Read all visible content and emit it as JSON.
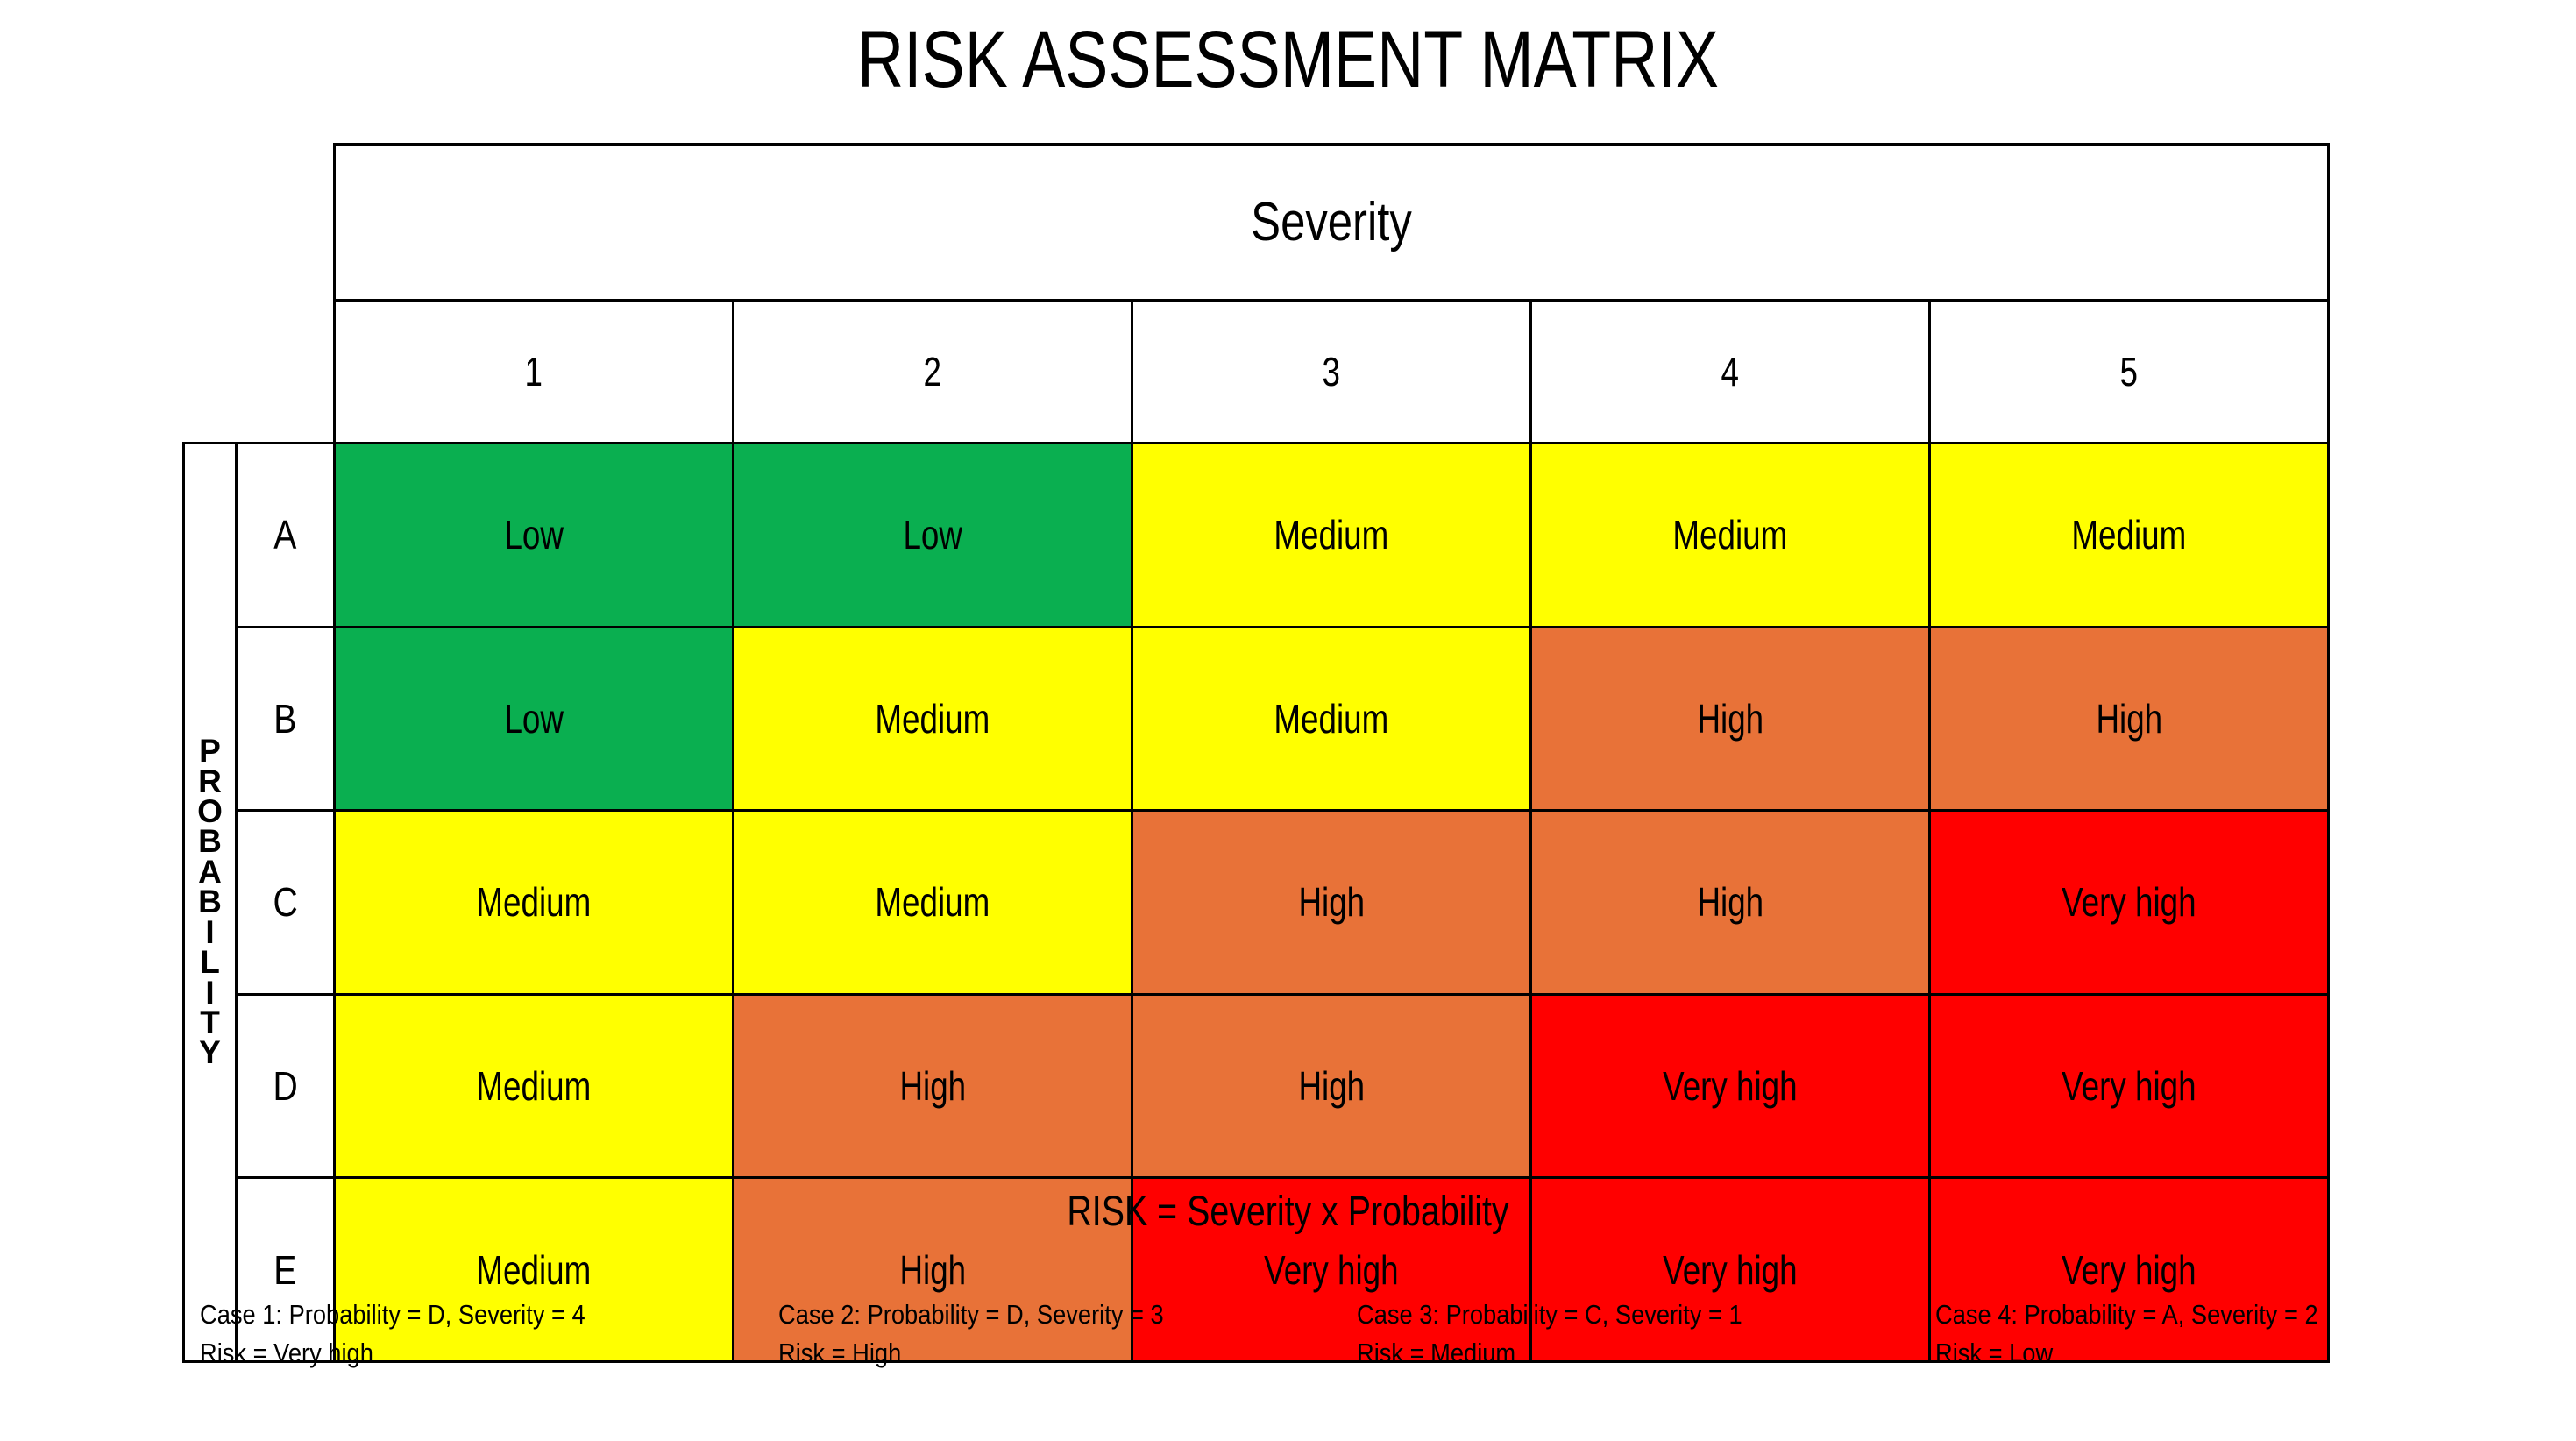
{
  "title": "RISK ASSESSMENT MATRIX",
  "axes": {
    "severity_label": "Severity",
    "probability_label": "PROBABILITY",
    "probability_letters": [
      "P",
      "R",
      "O",
      "B",
      "A",
      "B",
      "I",
      "L",
      "I",
      "T",
      "Y"
    ],
    "severity_levels": [
      "1",
      "2",
      "3",
      "4",
      "5"
    ],
    "probability_levels": [
      "A",
      "B",
      "C",
      "D",
      "E"
    ]
  },
  "formula": "RISK = Severity x Probability",
  "legend_colors": {
    "low": "#0AAF50",
    "medium": "#FFFF00",
    "high": "#E87238",
    "very_high": "#FF0000",
    "border": "#000000",
    "background": "#FFFFFF"
  },
  "chart_data": {
    "type": "heatmap",
    "title": "RISK ASSESSMENT MATRIX",
    "xlabel": "Severity",
    "ylabel": "PROBABILITY",
    "x": [
      "1",
      "2",
      "3",
      "4",
      "5"
    ],
    "y": [
      "A",
      "B",
      "C",
      "D",
      "E"
    ],
    "grid": true,
    "legend_position": "none",
    "categories_scale": [
      "Low",
      "Medium",
      "High",
      "Very high"
    ],
    "category_colors": {
      "Low": "#0AAF50",
      "Medium": "#FFFF00",
      "High": "#E87238",
      "Very high": "#FF0000"
    },
    "cells": [
      [
        "Low",
        "Low",
        "Medium",
        "Medium",
        "Medium"
      ],
      [
        "Low",
        "Medium",
        "Medium",
        "High",
        "High"
      ],
      [
        "Medium",
        "Medium",
        "High",
        "High",
        "Very high"
      ],
      [
        "Medium",
        "High",
        "High",
        "Very high",
        "Very high"
      ],
      [
        "Medium",
        "High",
        "Very high",
        "Very high",
        "Very high"
      ]
    ]
  },
  "matrix": {
    "rows": [
      {
        "label": "A",
        "cells": [
          {
            "text": "Low",
            "color": "#0AAF50"
          },
          {
            "text": "Low",
            "color": "#0AAF50"
          },
          {
            "text": "Medium",
            "color": "#FFFF00"
          },
          {
            "text": "Medium",
            "color": "#FFFF00"
          },
          {
            "text": "Medium",
            "color": "#FFFF00"
          }
        ]
      },
      {
        "label": "B",
        "cells": [
          {
            "text": "Low",
            "color": "#0AAF50"
          },
          {
            "text": "Medium",
            "color": "#FFFF00"
          },
          {
            "text": "Medium",
            "color": "#FFFF00"
          },
          {
            "text": "High",
            "color": "#E87238"
          },
          {
            "text": "High",
            "color": "#E87238"
          }
        ]
      },
      {
        "label": "C",
        "cells": [
          {
            "text": "Medium",
            "color": "#FFFF00"
          },
          {
            "text": "Medium",
            "color": "#FFFF00"
          },
          {
            "text": "High",
            "color": "#E87238"
          },
          {
            "text": "High",
            "color": "#E87238"
          },
          {
            "text": "Very high",
            "color": "#FF0000"
          }
        ]
      },
      {
        "label": "D",
        "cells": [
          {
            "text": "Medium",
            "color": "#FFFF00"
          },
          {
            "text": "High",
            "color": "#E87238"
          },
          {
            "text": "High",
            "color": "#E87238"
          },
          {
            "text": "Very high",
            "color": "#FF0000"
          },
          {
            "text": "Very high",
            "color": "#FF0000"
          }
        ]
      },
      {
        "label": "E",
        "cells": [
          {
            "text": "Medium",
            "color": "#FFFF00"
          },
          {
            "text": "High",
            "color": "#E87238"
          },
          {
            "text": "Very high",
            "color": "#FF0000"
          },
          {
            "text": "Very high",
            "color": "#FF0000"
          },
          {
            "text": "Very high",
            "color": "#FF0000"
          }
        ]
      }
    ]
  },
  "cases": [
    {
      "line1": "Case 1: Probability = D, Severity = 4",
      "line2": "Risk = Very high"
    },
    {
      "line1": "Case 2: Probability = D, Severity = 3",
      "line2": "Risk = High"
    },
    {
      "line1": "Case 3: Probability = C, Severity = 1",
      "line2": "Risk = Medium"
    },
    {
      "line1": "Case 4: Probability = A, Severity = 2",
      "line2": "Risk = Low"
    }
  ]
}
